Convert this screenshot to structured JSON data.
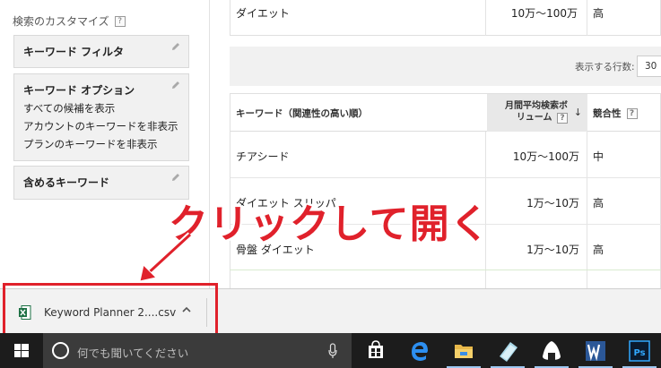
{
  "sidebar": {
    "title": "検索のカスタマイズ",
    "help": "?",
    "keyword_filter": "キーワード フィルタ",
    "keyword_options": {
      "title": "キーワード オプション",
      "lines": [
        "すべての候補を表示",
        "アカウントのキーワードを非表示",
        "プランのキーワードを非表示"
      ]
    },
    "include_keywords": "含めるキーワード"
  },
  "top_row": {
    "keyword": "ダイエット",
    "volume": "10万～100万",
    "competition": "高"
  },
  "rows_control": {
    "label": "表示する行数:",
    "value": "30"
  },
  "table": {
    "headers": {
      "keyword": "キーワード（関連性の高い順）",
      "volume_line1": "月間平均検索ボ",
      "volume_line2": "リューム",
      "help": "?",
      "sort_arrow": "↓",
      "competition": "競合性"
    },
    "rows": [
      {
        "keyword": "チアシード",
        "volume": "10万～100万",
        "competition": "中"
      },
      {
        "keyword": "ダイエット スリッパ",
        "volume": "1万～10万",
        "competition": "高"
      },
      {
        "keyword": "骨盤 ダイエット",
        "volume": "1万～10万",
        "competition": "高"
      }
    ]
  },
  "download": {
    "file_name": "Keyword Planner 2....csv",
    "chevron": "^"
  },
  "annotation": "クリックして開く",
  "taskbar": {
    "search_placeholder": "何でも聞いてください"
  },
  "colors": {
    "annotation_red": "#e0212b",
    "excel_green": "#1e7145",
    "taskbar_bg": "#1c1c1c"
  }
}
